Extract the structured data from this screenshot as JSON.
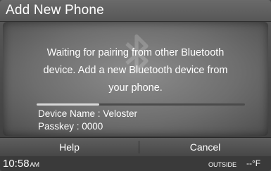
{
  "window": {
    "title": "Add New Phone"
  },
  "dialog": {
    "message_line1": "Waiting for pairing from other Bluetooth",
    "message_line2": "device. Add a new Bluetooth device from",
    "message_line3": "your phone.",
    "progress_fraction": 0.3,
    "device_name_text": "Device Name : Veloster",
    "passkey_text": "Passkey : 0000",
    "background_icon": "bluetooth-icon"
  },
  "buttons": {
    "help_label": "Help",
    "cancel_label": "Cancel"
  },
  "status": {
    "time": "10:58",
    "ampm": "AM",
    "outside_label": "OUTSIDE",
    "outside_temp": "--°F"
  },
  "colors": {
    "text": "#ffffff",
    "progress_fill": "#d8d8d8"
  }
}
